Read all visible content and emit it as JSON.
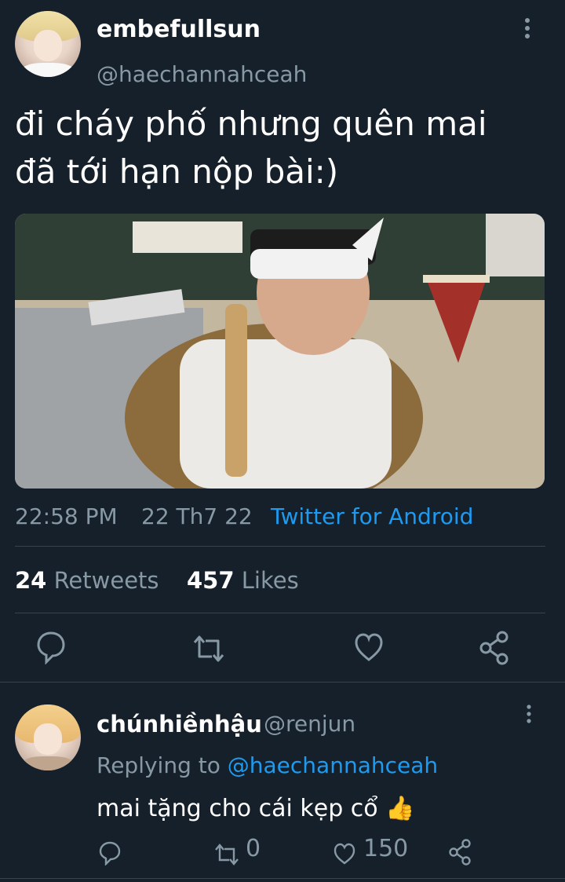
{
  "tweet": {
    "display_name": "embefullsun",
    "handle": "@haechannahceah",
    "text_line1": "đi cháy phố nhưng quên mai",
    "text_line2": "đã tới hạn nộp bài:)",
    "time": "22:58 PM",
    "date": "22 Th7 22",
    "source": "Twitter for Android",
    "retweets_count": "24",
    "retweets_label": "Retweets",
    "likes_count": "457",
    "likes_label": "Likes",
    "icons": [
      "more-vertical-icon",
      "reply-icon",
      "retweet-icon",
      "like-icon",
      "share-icon"
    ]
  },
  "reply": {
    "display_name": "chúnhiềnhậu",
    "handle": "@renjun",
    "replying_label": "Replying to",
    "replying_to": "@haechannahceah",
    "text": "mai tặng cho cái kẹp cổ",
    "emoji": "👍",
    "retweets": "0",
    "likes": "150"
  },
  "colors": {
    "background": "#15202b",
    "secondary_text": "#8899a6",
    "accent": "#1d9bf0",
    "divider": "#38444d"
  }
}
